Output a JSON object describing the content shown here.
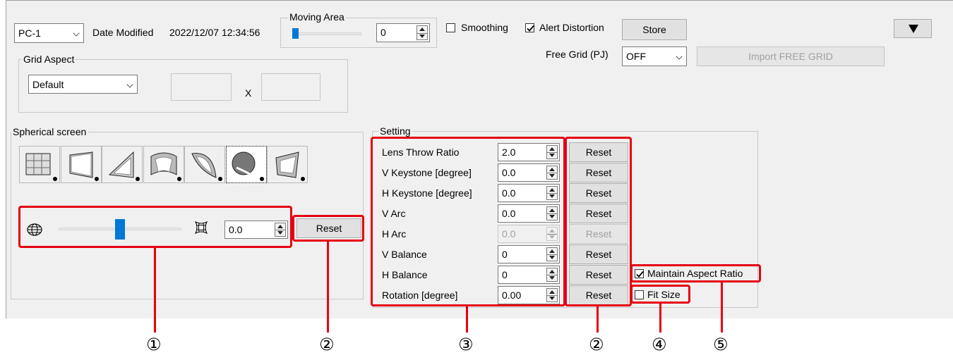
{
  "header": {
    "pc_select": "PC-1",
    "date_label": "Date Modified",
    "date_value": "2022/12/07 12:34:56",
    "moving_area": {
      "title": "Moving Area",
      "value": "0",
      "slider_level": 0.0
    },
    "smoothing": {
      "label": "Smoothing",
      "checked": false
    },
    "alert_distortion": {
      "label": "Alert Distortion",
      "checked": true
    },
    "store_label": "Store",
    "free_grid_label": "Free Grid (PJ)",
    "free_grid_value": "OFF",
    "import_label": "Import FREE GRID",
    "menu_glyph": "▼"
  },
  "grid_aspect": {
    "title": "Grid Aspect",
    "select_value": "Default",
    "x_label": "X",
    "width_value": "",
    "height_value": ""
  },
  "spherical": {
    "title": "Spherical screen",
    "shapes": [
      {
        "name": "flat-grid-icon"
      },
      {
        "name": "flat-screen-icon"
      },
      {
        "name": "angled-screen-icon"
      },
      {
        "name": "cylinder-screen-icon"
      },
      {
        "name": "curved-screen-icon"
      },
      {
        "name": "dome-screen-icon",
        "selected": true
      },
      {
        "name": "tilted-screen-icon"
      }
    ],
    "slider_value": "0.0",
    "slider_level": 0.5,
    "reset_label": "Reset",
    "left_icon": "sphere-icon",
    "right_icon": "grid-warp-icon"
  },
  "setting": {
    "title": "Setting",
    "rows": [
      {
        "label": "Lens Throw Ratio",
        "value": "2.0",
        "reset": "Reset",
        "disabled": false
      },
      {
        "label": "V Keystone [degree]",
        "value": "0.0",
        "reset": "Reset",
        "disabled": false
      },
      {
        "label": "H Keystone [degree]",
        "value": "0.0",
        "reset": "Reset",
        "disabled": false
      },
      {
        "label": "V Arc",
        "value": "0.0",
        "reset": "Reset",
        "disabled": false
      },
      {
        "label": "H Arc",
        "value": "0.0",
        "reset": "Reset",
        "disabled": true
      },
      {
        "label": "V Balance",
        "value": "0",
        "reset": "Reset",
        "disabled": false
      },
      {
        "label": "H Balance",
        "value": "0",
        "reset": "Reset",
        "disabled": false
      },
      {
        "label": "Rotation [degree]",
        "value": "0.00",
        "reset": "Reset",
        "disabled": false
      }
    ],
    "maintain_aspect": {
      "label": "Maintain Aspect Ratio",
      "checked": true
    },
    "fit_size": {
      "label": "Fit Size",
      "checked": false
    }
  },
  "callouts": [
    "①",
    "②",
    "③",
    "②",
    "④",
    "⑤"
  ],
  "colors": {
    "highlight": "#e60012",
    "accent": "#0078d7",
    "panel": "#f0f0f0"
  }
}
